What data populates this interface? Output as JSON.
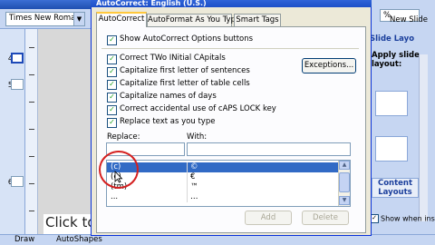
{
  "app": {
    "font_combo": "Times New Roman",
    "zoom_value": "%",
    "new_slide_label": "New Slide",
    "slide_numbers": [
      "4",
      "5",
      "6"
    ],
    "slide_click_text": "Click to",
    "task_pane": {
      "title": "Slide Layo",
      "apply_text": "Apply slide layout:",
      "content_layouts": "Content Layouts",
      "show_when_insert": "Show when inser"
    },
    "draw_label": "Draw",
    "autoshapes_label": "AutoShapes"
  },
  "dialog": {
    "title": "AutoCorrect: English (U.S.)",
    "tabs": [
      {
        "label": "AutoCorrect",
        "active": true
      },
      {
        "label": "AutoFormat As You Type",
        "active": false
      },
      {
        "label": "Smart Tags",
        "active": false
      }
    ],
    "show_options": {
      "label": "Show AutoCorrect Options buttons",
      "checked": true
    },
    "checkboxes": [
      {
        "label": "Correct TWo INitial CApitals",
        "checked": true
      },
      {
        "label": "Capitalize first letter of sentences",
        "checked": true
      },
      {
        "label": "Capitalize first letter of table cells",
        "checked": true
      },
      {
        "label": "Capitalize names of days",
        "checked": true
      },
      {
        "label": "Correct accidental use of cAPS LOCK key",
        "checked": true
      },
      {
        "label": "Replace text as you type",
        "checked": true
      }
    ],
    "exceptions_label": "Exceptions...",
    "replace_label": "Replace:",
    "with_label": "With:",
    "replace_value": "",
    "with_value": "",
    "list_rows": [
      {
        "replace": "(c)",
        "with": "©",
        "selected": true
      },
      {
        "replace": "(e)",
        "with": "€",
        "selected": false
      },
      {
        "replace": "(tm)",
        "with": "™",
        "selected": false
      },
      {
        "replace": "...",
        "with": "…",
        "selected": false
      }
    ],
    "add_label": "Add",
    "delete_label": "Delete"
  },
  "colors": {
    "title_bar": "#1c4fc8",
    "selected_row": "#316ac5",
    "highlight_circle": "#d42020",
    "check_mark": "#21a121"
  }
}
